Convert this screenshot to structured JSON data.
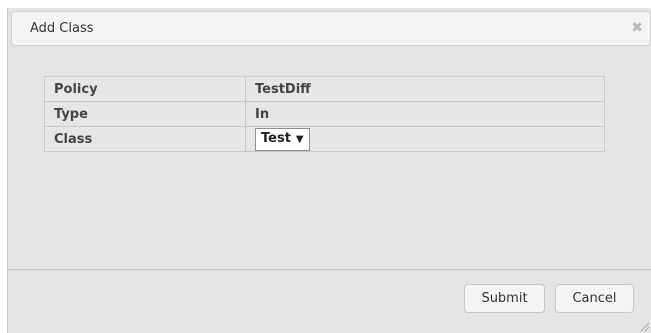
{
  "dialog": {
    "title": "Add Class",
    "close_icon": "close-icon"
  },
  "form": {
    "rows": [
      {
        "label": "Policy",
        "value": "TestDiff"
      },
      {
        "label": "Type",
        "value": "In"
      },
      {
        "label": "Class",
        "value": "Test"
      }
    ],
    "class_select_options": [
      "Test"
    ]
  },
  "footer": {
    "submit_label": "Submit",
    "cancel_label": "Cancel"
  }
}
